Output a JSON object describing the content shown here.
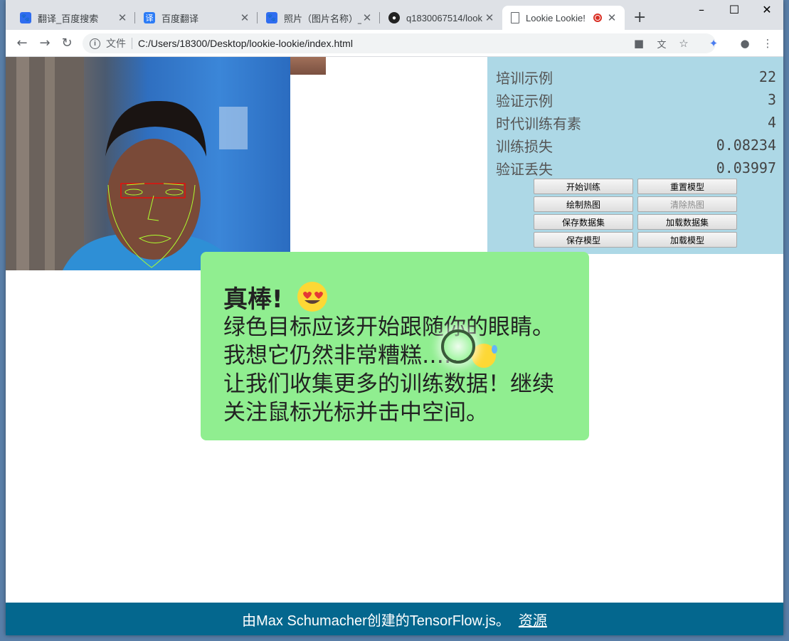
{
  "tabs": [
    {
      "title": "翻译_百度搜索",
      "icon": "baidu-paw-icon"
    },
    {
      "title": "百度翻译",
      "icon": "baidu-translate-icon"
    },
    {
      "title": "照片（图片名称）_百",
      "icon": "baidu-paw-icon"
    },
    {
      "title": "q1830067514/look",
      "icon": "github-icon"
    },
    {
      "title": "Lookie Lookie!",
      "icon": "page-icon",
      "active": true
    }
  ],
  "address": {
    "scheme_label": "文件",
    "url": "C:/Users/18300/Desktop/lookie-lookie/index.html"
  },
  "stats": [
    {
      "label": "培训示例",
      "value": "22"
    },
    {
      "label": "验证示例",
      "value": "3"
    },
    {
      "label": "时代训练有素",
      "value": "4"
    },
    {
      "label": "训练损失",
      "value": "0.08234"
    },
    {
      "label": "验证丢失",
      "value": "0.03997"
    }
  ],
  "buttons": [
    {
      "label": "开始训练",
      "enabled": true
    },
    {
      "label": "重置模型",
      "enabled": true
    },
    {
      "label": "绘制热图",
      "enabled": true
    },
    {
      "label": "清除热图",
      "enabled": false
    },
    {
      "label": "保存数据集",
      "enabled": true
    },
    {
      "label": "加载数据集",
      "enabled": true
    },
    {
      "label": "保存模型",
      "enabled": true
    },
    {
      "label": "加载模型",
      "enabled": true
    }
  ],
  "message": {
    "title": "真棒!",
    "lines": [
      "绿色目标应该开始跟随你的眼睛。",
      "我想它仍然非常糟糕……",
      "让我们收集更多的训练数据！继续",
      "关注鼠标光标并击中空间。"
    ]
  },
  "footer": {
    "text": "由Max Schumacher创建的TensorFlow.js。",
    "link": "资源"
  },
  "colors": {
    "stats_bg": "#add8e6",
    "message_bg": "#90ee90",
    "footer_bg": "#04678e",
    "mesh": "#adff2f",
    "eye_box": "#ff0000"
  }
}
